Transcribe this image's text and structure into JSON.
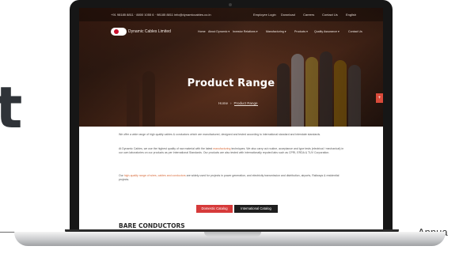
{
  "background_letter": "t",
  "annual_text": "Annua",
  "topbar": {
    "contact": "+91 98185 8811 · 8800 1055 6 · 98185 8811 info@dynamiccables.co.in",
    "links": [
      "Employee Login",
      "Download",
      "Careers",
      "Contact Us",
      "English"
    ]
  },
  "header": {
    "logo_text": "Dynamic Cables Limited",
    "nav": [
      "Home",
      "About Dynamic ▾",
      "Investor Relations ▾",
      "Manufacturing ▾",
      "Products ▾",
      "Quality Assurance ▾",
      "Contact Us"
    ]
  },
  "hero": {
    "title": "Product Range",
    "breadcrumb_home": "Home",
    "breadcrumb_current": "Product Range",
    "side_button": "+"
  },
  "content": {
    "p1": "We offer a wide range of high quality cables & conductors which are manufactured, designed and tested according to international standard and interstate standards.",
    "p2_a": "At Dynamic Cables, we use the highest quality of raw material with the latest",
    "p2_highlight": "manufacturing",
    "p2_b": "techniques. We also carry out routine, acceptance and type tests (electrical / mechanical) in our own laboratories on our products as per International Standards. Our products are also tested with internationally reputed labs such as CPRI, ERDA & TUV Corporation.",
    "p3_a": "Our",
    "p3_highlight": "high-quality range of wires, cables and conductors",
    "p3_b": "are widely used for projects in power generation, and electricity transmission and distribution, airports, Railways & residential projects.",
    "buttons": [
      "Domestic Catalog",
      "International Catalog"
    ],
    "section_heading": "BARE CONDUCTORS"
  },
  "colors": {
    "accent_red": "#d63a3a",
    "dark_button": "#1e1e1e",
    "highlight": "#d86b3a"
  }
}
